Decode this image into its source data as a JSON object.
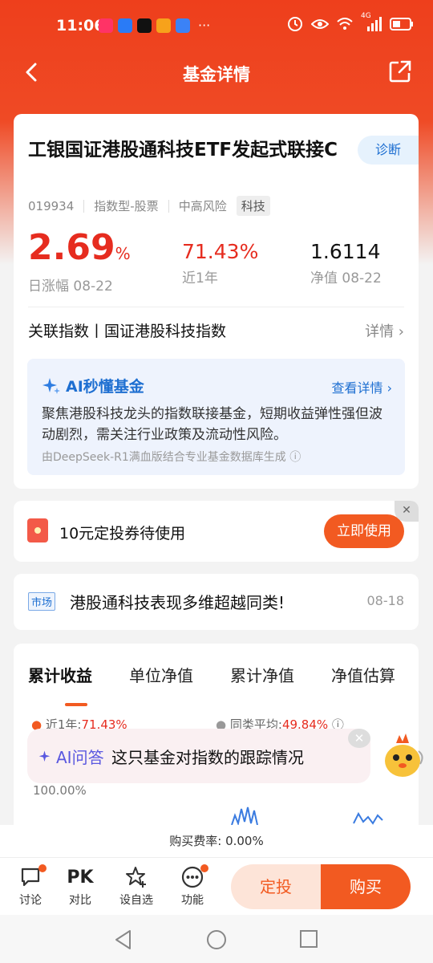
{
  "status_bar": {
    "time": "11:06",
    "more": "···",
    "network": "4G",
    "apps": [
      "app-icon",
      "shield-app-icon",
      "tiktok-icon",
      "video-app-icon",
      "bulb-app-icon"
    ]
  },
  "header": {
    "title": "基金详情"
  },
  "fund": {
    "name": "工银国证港股通科技ETF发起式联接C",
    "diagnose_label": "诊断",
    "code": "019934",
    "type": "指数型-股票",
    "risk": "中高风险",
    "sector_tag": "科技",
    "daily_change": "2.69",
    "daily_change_unit": "%",
    "daily_change_label": "日涨幅 08-22",
    "year_return": "71.43%",
    "year_return_label": "近1年",
    "nav": "1.6114",
    "nav_label": "净值 08-22",
    "index_label": "关联指数丨国证港股科技指数",
    "index_detail": "详情 ›"
  },
  "ai_summary": {
    "title": "AI秒懂基金",
    "more": "查看详情 ›",
    "text": "聚焦港股科技龙头的指数联接基金，短期收益弹性强但波动剧烈，需关注行业政策及流动性风险。",
    "source": "由DeepSeek-R1满血版结合专业基金数据库生成 ⓘ"
  },
  "coupon": {
    "text": "10元定投券待使用",
    "button": "立即使用",
    "close": "✕"
  },
  "news": {
    "tag": "市场",
    "title": "港股通科技表现多维超越同类!",
    "date": "08-18"
  },
  "chart_tabs": [
    "累计收益",
    "单位净值",
    "累计净值",
    "净值估算"
  ],
  "chart_legend": {
    "fund_label": "近1年:",
    "fund_value": "71.43%",
    "peer_label": "同类平均:",
    "peer_value": "49.84%",
    "info": "ⓘ"
  },
  "chart_axis": {
    "y_top": "100.00%"
  },
  "ai_ask": {
    "label": "AI问答",
    "text": "这只基金对指数的跟踪情况",
    "close": "✕"
  },
  "fee": {
    "text": "购买费率: 0.00%"
  },
  "bottom_tools": [
    {
      "label": "讨论"
    },
    {
      "label": "对比",
      "icon_text": "PK"
    },
    {
      "label": "设自选"
    },
    {
      "label": "功能"
    }
  ],
  "actions": {
    "dingtou": "定投",
    "buy": "购买"
  },
  "colors": {
    "brand_red": "#ee3f1c",
    "up_red": "#e62c1f",
    "action_orange": "#f25a21",
    "ai_blue": "#1e6fd1"
  }
}
